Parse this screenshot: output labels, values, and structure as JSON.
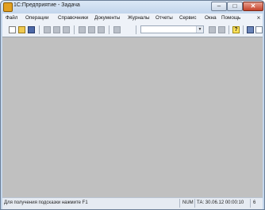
{
  "window": {
    "title": "1С:Предприятие - Задача",
    "minimize": "–",
    "maximize": "□",
    "close": "✕"
  },
  "menu": {
    "items": [
      {
        "label": "Файл"
      },
      {
        "label": "Операции"
      },
      {
        "label": "Справочники"
      },
      {
        "label": "Документы"
      },
      {
        "label": "Журналы"
      },
      {
        "label": "Отчеты"
      },
      {
        "label": "Сервис"
      },
      {
        "label": "Окна"
      },
      {
        "label": "Помощь"
      }
    ],
    "close": "×"
  },
  "toolbar": {
    "icons": [
      "new-document-icon",
      "open-folder-icon",
      "save-icon",
      "cut-icon",
      "copy-icon",
      "paste-icon",
      "print-icon",
      "undo-icon",
      "redo-icon",
      "find-icon",
      "find-prev-icon",
      "find-next-icon",
      "help-icon",
      "calculator-icon",
      "calendar-icon",
      "arrow-icon"
    ],
    "search_value": "",
    "help_glyph": "?"
  },
  "status": {
    "hint": "Для получения подсказки нажмите F1",
    "num": "NUM",
    "ta": "ТА: 30.06.12  00:00:10",
    "page": "6"
  }
}
